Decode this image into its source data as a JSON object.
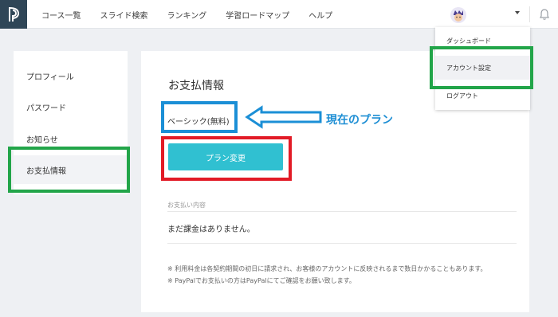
{
  "nav": {
    "items": [
      "コース一覧",
      "スライド検索",
      "ランキング",
      "学習ロードマップ",
      "ヘルプ"
    ]
  },
  "sidebar": {
    "items": [
      {
        "label": "プロフィール"
      },
      {
        "label": "パスワード"
      },
      {
        "label": "お知らせ"
      },
      {
        "label": "お支払情報",
        "active": true
      }
    ]
  },
  "main": {
    "title": "お支払情報",
    "current_plan": "ベーシック(無料)",
    "plan_button_label": "プラン変更",
    "history_label": "お支払い内容",
    "history_empty": "まだ課金はありません。",
    "notes": [
      "※ 利用料金は各契約期間の初日に請求され、お客様のアカウントに反映されるまで数日かかることもあります。",
      "※ PayPalでお支払いの方はPayPalにてご確認をお願い致します。"
    ]
  },
  "dropdown": {
    "items": [
      {
        "label": "ダッシュボード"
      },
      {
        "label": "アカウント設定",
        "highlighted": true
      },
      {
        "label": "ログアウト"
      }
    ]
  },
  "annotation": {
    "label": "現在のプラン"
  },
  "colors": {
    "accent": "#30c0d1",
    "logo_bg": "#2f4657",
    "annotation_green": "#22a549",
    "annotation_blue": "#1b8fd6",
    "annotation_red": "#e21b26"
  },
  "icons": [
    "logo-icon",
    "avatar-icon",
    "caret-down-icon",
    "bell-icon"
  ]
}
